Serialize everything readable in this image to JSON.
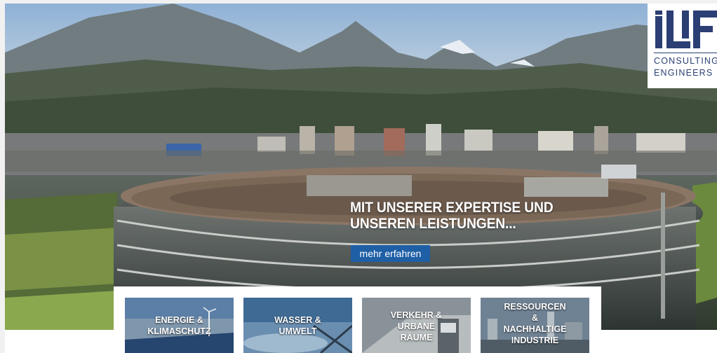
{
  "hero": {
    "headline_line1": "MIT UNSERER EXPERTISE UND",
    "headline_line2": "UNSEREN LEISTUNGEN...",
    "cta_label": "mehr erfahren",
    "cta_color": "#1f5fa6"
  },
  "logo": {
    "mark_text": "ILF",
    "line1": "CONSULTING",
    "line2": "ENGINEERS",
    "color": "#2b3f74"
  },
  "tiles": [
    {
      "lines": [
        "ENERGIE &",
        "KLIMASCHUTZ"
      ]
    },
    {
      "lines": [
        "WASSER &",
        "UMWELT"
      ]
    },
    {
      "lines": [
        "VERKEHR &",
        "URBANE",
        "RÄUME"
      ]
    },
    {
      "lines": [
        "RESSOURCEN",
        "&",
        "NACHHALTIGE",
        "INDUSTRIE"
      ]
    }
  ]
}
